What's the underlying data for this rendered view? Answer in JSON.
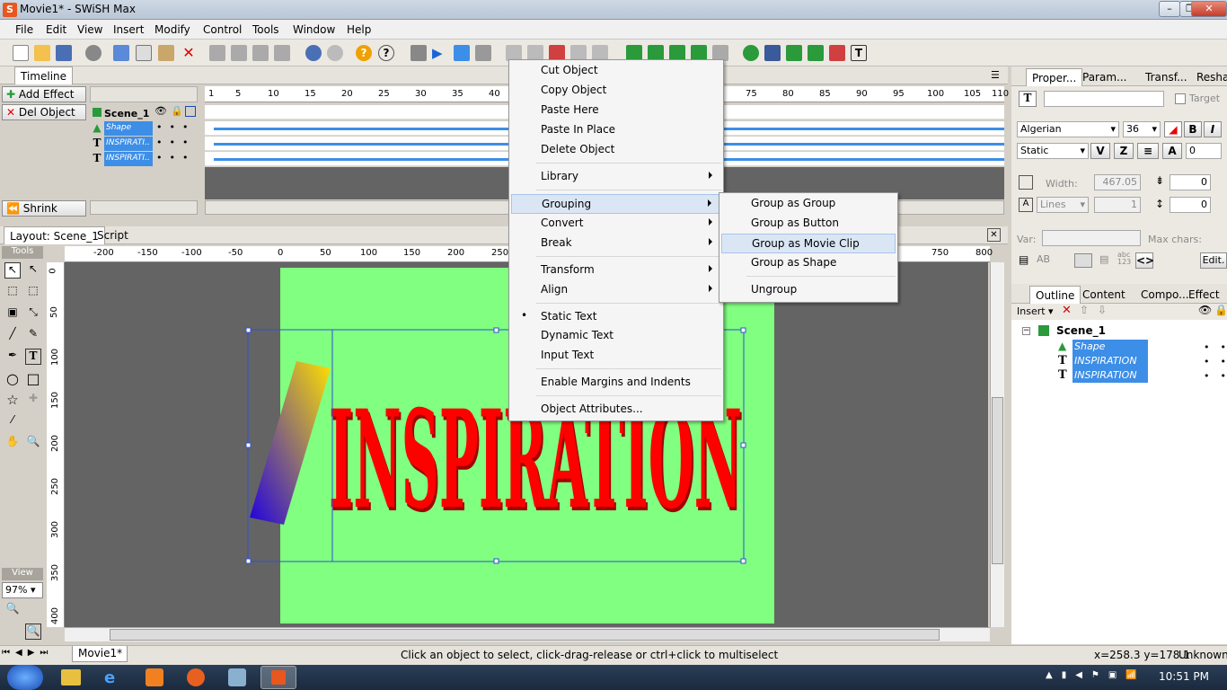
{
  "window": {
    "title": "Movie1* - SWiSH Max",
    "app_icon": "swish-icon"
  },
  "menubar": [
    "File",
    "Edit",
    "View",
    "Insert",
    "Modify",
    "Control",
    "Tools",
    "Window",
    "Help"
  ],
  "timeline": {
    "tab": "Timeline",
    "add_effect": "Add Effect",
    "del_object": "Del Object",
    "shrink": "Shrink",
    "scene": "Scene_1",
    "rows": [
      {
        "name": "Shape",
        "icon": "shape-icon"
      },
      {
        "name": "INSPIRATI..",
        "icon": "text-icon"
      },
      {
        "name": "INSPIRATI..",
        "icon": "text-icon"
      }
    ],
    "frame_ticks": [
      "1",
      "5",
      "10",
      "15",
      "20",
      "25",
      "30",
      "35",
      "40",
      "",
      "",
      "",
      "",
      "75",
      "80",
      "85",
      "90",
      "95",
      "100",
      "105",
      "110"
    ]
  },
  "layout": {
    "tabs": [
      "Layout: Scene_1",
      "Script"
    ],
    "tools_label": "Tools",
    "view_label": "View",
    "zoom": "97%",
    "h_ruler": [
      "-200",
      "-150",
      "-100",
      "-50",
      "0",
      "50",
      "100",
      "150",
      "200",
      "250",
      "",
      "",
      "",
      "",
      "",
      "",
      "",
      "750",
      "800"
    ],
    "v_ruler": [
      "0",
      "50",
      "100",
      "150",
      "200",
      "250",
      "300",
      "350",
      "400"
    ],
    "stage_text": "INSPIRATION",
    "stage_color": "#80ff80",
    "text_color": "#ff0000",
    "movie_tab": "Movie1*"
  },
  "properties": {
    "tabs": [
      "Proper...",
      "Param...",
      "Transf...",
      "Reshape"
    ],
    "target_label": "Target",
    "font": "Algerian",
    "size": "36",
    "text_type": "Static",
    "width_label": "Width:",
    "width_value": "467.05",
    "spacing_value": "0",
    "lines": "Lines",
    "lines_value": "1",
    "leading_value": "0",
    "var_label": "Var:",
    "maxchars_label": "Max chars:",
    "edit_btn": "Edit.",
    "tracking_value": "0"
  },
  "outline": {
    "tabs": [
      "Outline",
      "Content",
      "Compo...",
      "Effect"
    ],
    "insert": "Insert",
    "scene": "Scene_1",
    "items": [
      "Shape",
      "INSPIRATION",
      "INSPIRATION"
    ]
  },
  "context_menu": {
    "items": [
      "Cut Object",
      "Copy Object",
      "Paste Here",
      "Paste In Place",
      "Delete Object",
      "Library",
      "Grouping",
      "Convert",
      "Break",
      "Transform",
      "Align",
      "Static Text",
      "Dynamic Text",
      "Input Text",
      "Enable Margins and Indents",
      "Object Attributes..."
    ],
    "submenu": [
      "Group as Group",
      "Group as Button",
      "Group as Movie Clip",
      "Group as Shape",
      "Ungroup"
    ]
  },
  "status": {
    "message": "Click an object to select, click-drag-release or ctrl+click to multiselect",
    "coords": "x=258.3 y=178.1",
    "extra": "Unknown"
  },
  "taskbar": {
    "time": "10:51 PM"
  }
}
